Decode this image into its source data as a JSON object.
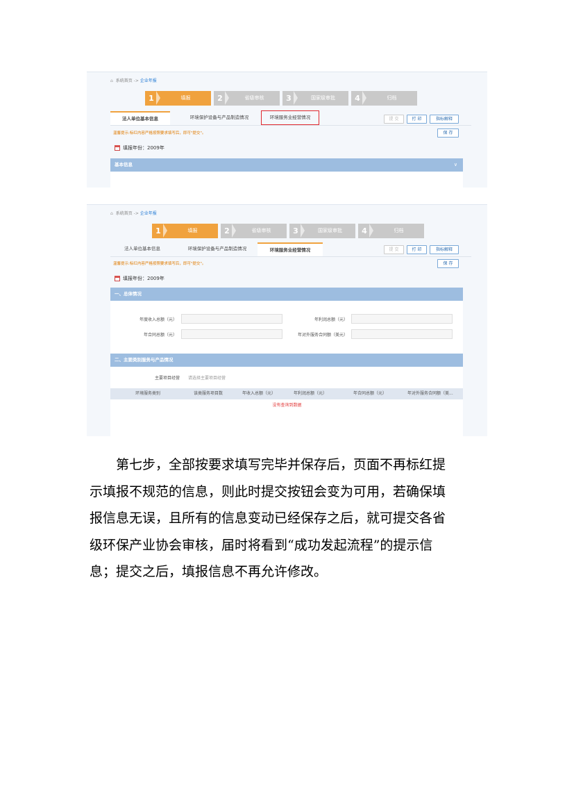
{
  "breadcrumb": {
    "home": "系统首页",
    "sep": "->",
    "current": "企业年报"
  },
  "steps": [
    {
      "num": "1",
      "label": "填报"
    },
    {
      "num": "2",
      "label": "省级审核"
    },
    {
      "num": "3",
      "label": "国家级审批"
    },
    {
      "num": "4",
      "label": "归档"
    }
  ],
  "tabs": [
    "法人单位基本信息",
    "环境保护设备与产品制造情况",
    "环境服务业经营情况"
  ],
  "buttons": {
    "submit": "提 交",
    "print": "打 印",
    "explain": "指标解释",
    "save": "保 存"
  },
  "warning1": "温馨提示:标红内容严格按照要求填写后，即可\"提交\"。",
  "warning2": "温馨提示:标红内容严格按照要求填写后，即可\"提交\"。",
  "year_label": "填报年份：2009年",
  "shot1_section": "基本信息",
  "shot2": {
    "section1": "一、总体情况",
    "fields": [
      "年度收入总额（元）",
      "年利润总额（元）",
      "年合同总额（元）",
      "年对外服务合同额（美元）"
    ],
    "section2": "二、主要类别服务与产品情况",
    "main_project_label": "主要项目经营",
    "main_project_placeholder": "请选择主要项目经营",
    "columns": [
      "环境服务类别",
      "该类服务项目数",
      "年收入总额（元）",
      "年利润总额（元）",
      "年合同总额（元）",
      "年对外服务合同额（美..."
    ],
    "empty": "没有查询到数据"
  },
  "paragraph_lines": [
    "第七步，全部按要求填写完毕并保存后，页面不再标红提",
    "示填报不规范的信息，则此时提交按钮会变为可用，若确保填",
    "报信息无误，且所有的信息变动已经保存之后，就可提交各省",
    "级环保产业协会审核，届时将看到“成功发起流程”的提示信",
    "息；提交之后，填报信息不再允许修改。"
  ]
}
